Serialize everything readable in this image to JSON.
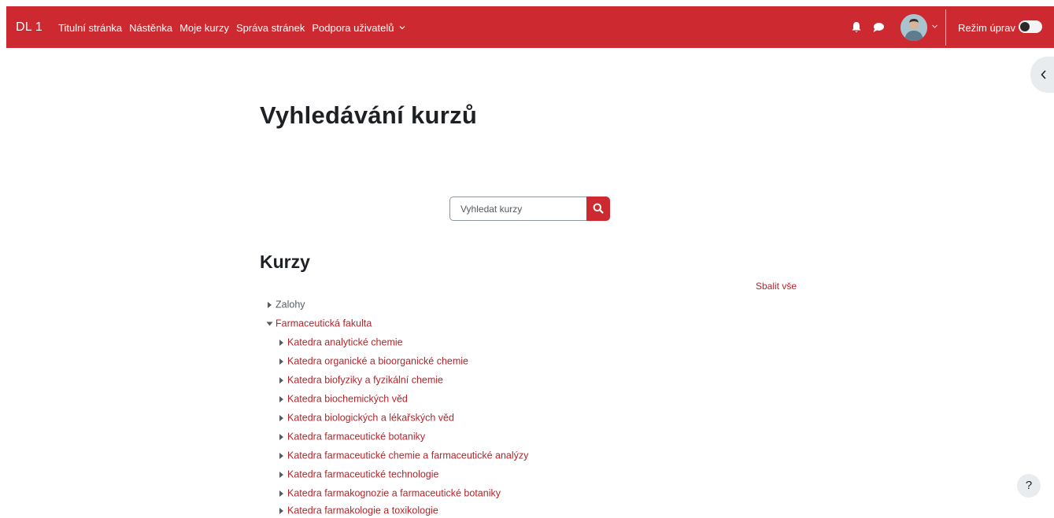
{
  "header": {
    "brand": "DL 1",
    "nav": [
      {
        "label": "Titulní stránka"
      },
      {
        "label": "Nástěnka"
      },
      {
        "label": "Moje kurzy"
      },
      {
        "label": "Správa stránek"
      },
      {
        "label": "Podpora uživatelů",
        "has_dropdown": true
      }
    ],
    "edit_mode_label": "Režim úprav",
    "edit_mode_on": false,
    "icons": [
      "bell-icon",
      "chat-icon",
      "avatar",
      "chevron-down-icon"
    ]
  },
  "main": {
    "page_title": "Vyhledávání kurzů",
    "search": {
      "placeholder": "Vyhledat kurzy",
      "value": ""
    },
    "section_title": "Kurzy",
    "collapse_all": "Sbalit vše",
    "tree": [
      {
        "label": "Zalohy",
        "expanded": false,
        "level": 0
      },
      {
        "label": "Farmaceutická fakulta",
        "expanded": true,
        "level": 0
      },
      {
        "label": "Katedra analytické chemie",
        "level": 1
      },
      {
        "label": "Katedra organické a bioorganické chemie",
        "level": 1
      },
      {
        "label": "Katedra biofyziky a fyzikální chemie",
        "level": 1
      },
      {
        "label": "Katedra biochemických věd",
        "level": 1
      },
      {
        "label": "Katedra biologických a lékařských věd",
        "level": 1
      },
      {
        "label": "Katedra farmaceutické botaniky",
        "level": 1
      },
      {
        "label": "Katedra farmaceutické chemie a farmaceutické analýzy",
        "level": 1
      },
      {
        "label": "Katedra farmaceutické technologie",
        "level": 1
      },
      {
        "label": "Katedra farmakognozie a farmaceutické botaniky",
        "level": 1
      },
      {
        "label": "Katedra farmakologie a toxikologie",
        "level": 1
      }
    ],
    "help_label": "?"
  },
  "colors": {
    "brand": "#cc2a30",
    "link": "#b3262c",
    "muted": "#555b61",
    "heading": "#1d2125"
  }
}
